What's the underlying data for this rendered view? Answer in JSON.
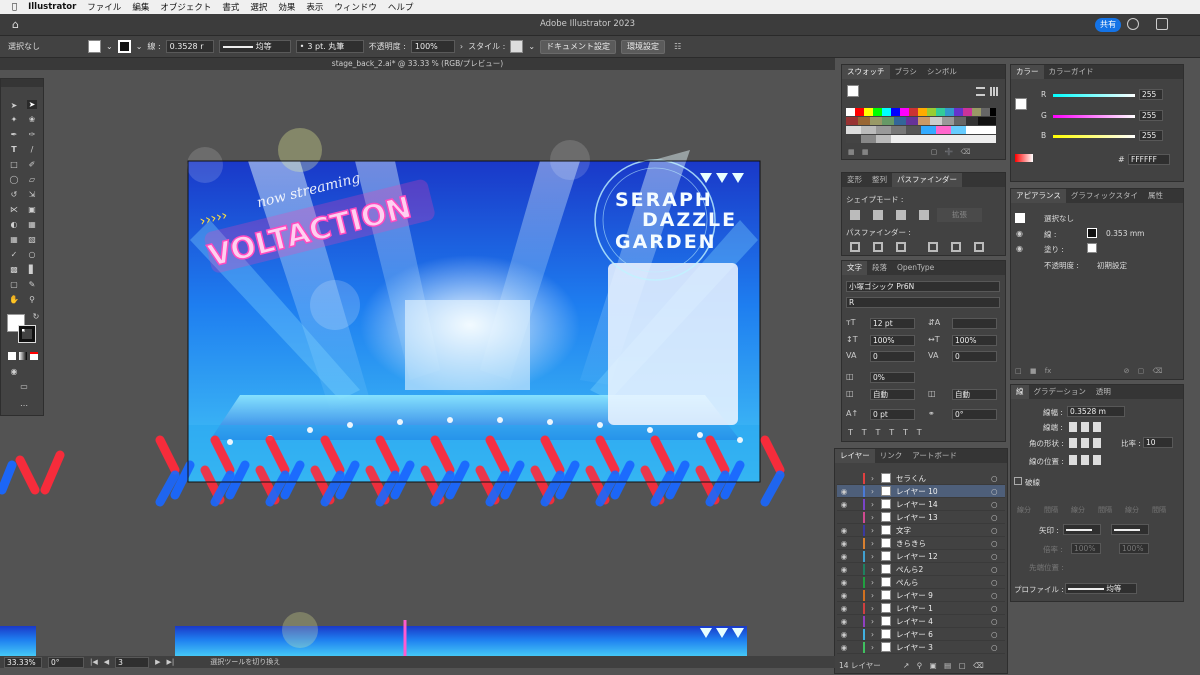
{
  "menubar": {
    "apple": "",
    "app": "Illustrator",
    "items": [
      "ファイル",
      "編集",
      "オブジェクト",
      "書式",
      "選択",
      "効果",
      "表示",
      "ウィンドウ",
      "ヘルプ"
    ]
  },
  "titlebar": {
    "title": "Adobe Illustrator 2023",
    "share": "共有"
  },
  "control": {
    "selection": "選択なし",
    "stroke_label": "線 :",
    "stroke_value": "0.3528 r",
    "profile": "均等",
    "brush": "3 pt. 丸筆",
    "opacity_label": "不透明度 :",
    "opacity_value": "100%",
    "style_label": "スタイル :",
    "doc_settings": "ドキュメント設定",
    "prefs": "環境設定"
  },
  "doc_tab": {
    "title": "stage_back_2.ai* @ 33.33 % (RGB/プレビュー)"
  },
  "status": {
    "zoom": "33.33%",
    "rotate": "0°",
    "artboard": "3",
    "tool_hint": "選択ツールを切り換え"
  },
  "artwork": {
    "streaming": "now streaming",
    "voltaction": "VOLTACTION",
    "line1": "SERAPH",
    "line2": "DAZZLE",
    "line3": "GARDEN"
  },
  "swatch_panel": {
    "tabs": [
      "スウォッチ",
      "ブラシ",
      "シンボル"
    ]
  },
  "pathfinder_panel": {
    "tabs": [
      "変形",
      "整列",
      "パスファインダー"
    ],
    "shape_modes": "シェイプモード :",
    "expand": "拡張",
    "pathfinder": "パスファインダー :"
  },
  "char_panel": {
    "tabs": [
      "文字",
      "段落",
      "OpenType"
    ],
    "font": "小塚ゴシック Pr6N",
    "style": "R",
    "size": "12 pt",
    "leading": "",
    "scale_v": "100%",
    "scale_h": "100%",
    "tracking": "0",
    "kerning": "0",
    "baseline_pct": "0%",
    "auto1": "自動",
    "auto2": "自動",
    "shift": "0 pt",
    "rotate": "0°"
  },
  "layers_panel": {
    "tabs": [
      "レイヤー",
      "リンク",
      "アートボード"
    ],
    "count": "14 レイヤー",
    "layers": [
      {
        "name": "セラくん",
        "color": "#e04040",
        "eye": false
      },
      {
        "name": "レイヤー 10",
        "color": "#4a7ad8",
        "eye": true
      },
      {
        "name": "レイヤー 14",
        "color": "#7a44c8",
        "eye": true
      },
      {
        "name": "レイヤー 13",
        "color": "#d04a90",
        "eye": false
      },
      {
        "name": "文字",
        "color": "#3a3aa0",
        "eye": true
      },
      {
        "name": "きらきら",
        "color": "#d88030",
        "eye": true
      },
      {
        "name": "レイヤー 12",
        "color": "#40a0d0",
        "eye": true
      },
      {
        "name": "ぺんら2",
        "color": "#208060",
        "eye": true
      },
      {
        "name": "ぺんら",
        "color": "#20a040",
        "eye": true
      },
      {
        "name": "レイヤー 9",
        "color": "#d07020",
        "eye": true
      },
      {
        "name": "レイヤー 1",
        "color": "#d04040",
        "eye": true
      },
      {
        "name": "レイヤー 4",
        "color": "#9040c0",
        "eye": true
      },
      {
        "name": "レイヤー 6",
        "color": "#40b0e0",
        "eye": true
      },
      {
        "name": "レイヤー 3",
        "color": "#40c060",
        "eye": true
      }
    ]
  },
  "color_panel": {
    "tabs": [
      "カラー",
      "カラーガイド"
    ],
    "r": "255",
    "g": "255",
    "b": "255",
    "hex": "FFFFFF",
    "r_label": "R",
    "g_label": "G",
    "b_label": "B"
  },
  "appearance_panel": {
    "tabs": [
      "アピアランス",
      "グラフィックスタイ",
      "属性"
    ],
    "selection": "選択なし",
    "stroke_label": "線 :",
    "stroke_value": "0.353 mm",
    "fill_label": "塗り :",
    "opacity_label": "不透明度 :",
    "opacity_value": "初期設定"
  },
  "stroke_panel": {
    "tabs": [
      "線",
      "グラデーション",
      "透明"
    ],
    "width_label": "線幅 :",
    "width_value": "0.3528 m",
    "cap_label": "線端 :",
    "corner_label": "角の形状 :",
    "ratio_label": "比率 :",
    "ratio_value": "10",
    "align_label": "線の位置 :",
    "dashed": "破線",
    "dash_labels": [
      "線分",
      "間隔",
      "線分",
      "間隔",
      "線分",
      "間隔"
    ],
    "arrow_label": "矢印 :",
    "scale_label": "倍率 :",
    "scale1": "100%",
    "scale2": "100%",
    "tip_label": "先端位置 :",
    "profile_label": "プロファイル :",
    "profile_value": "均等"
  }
}
